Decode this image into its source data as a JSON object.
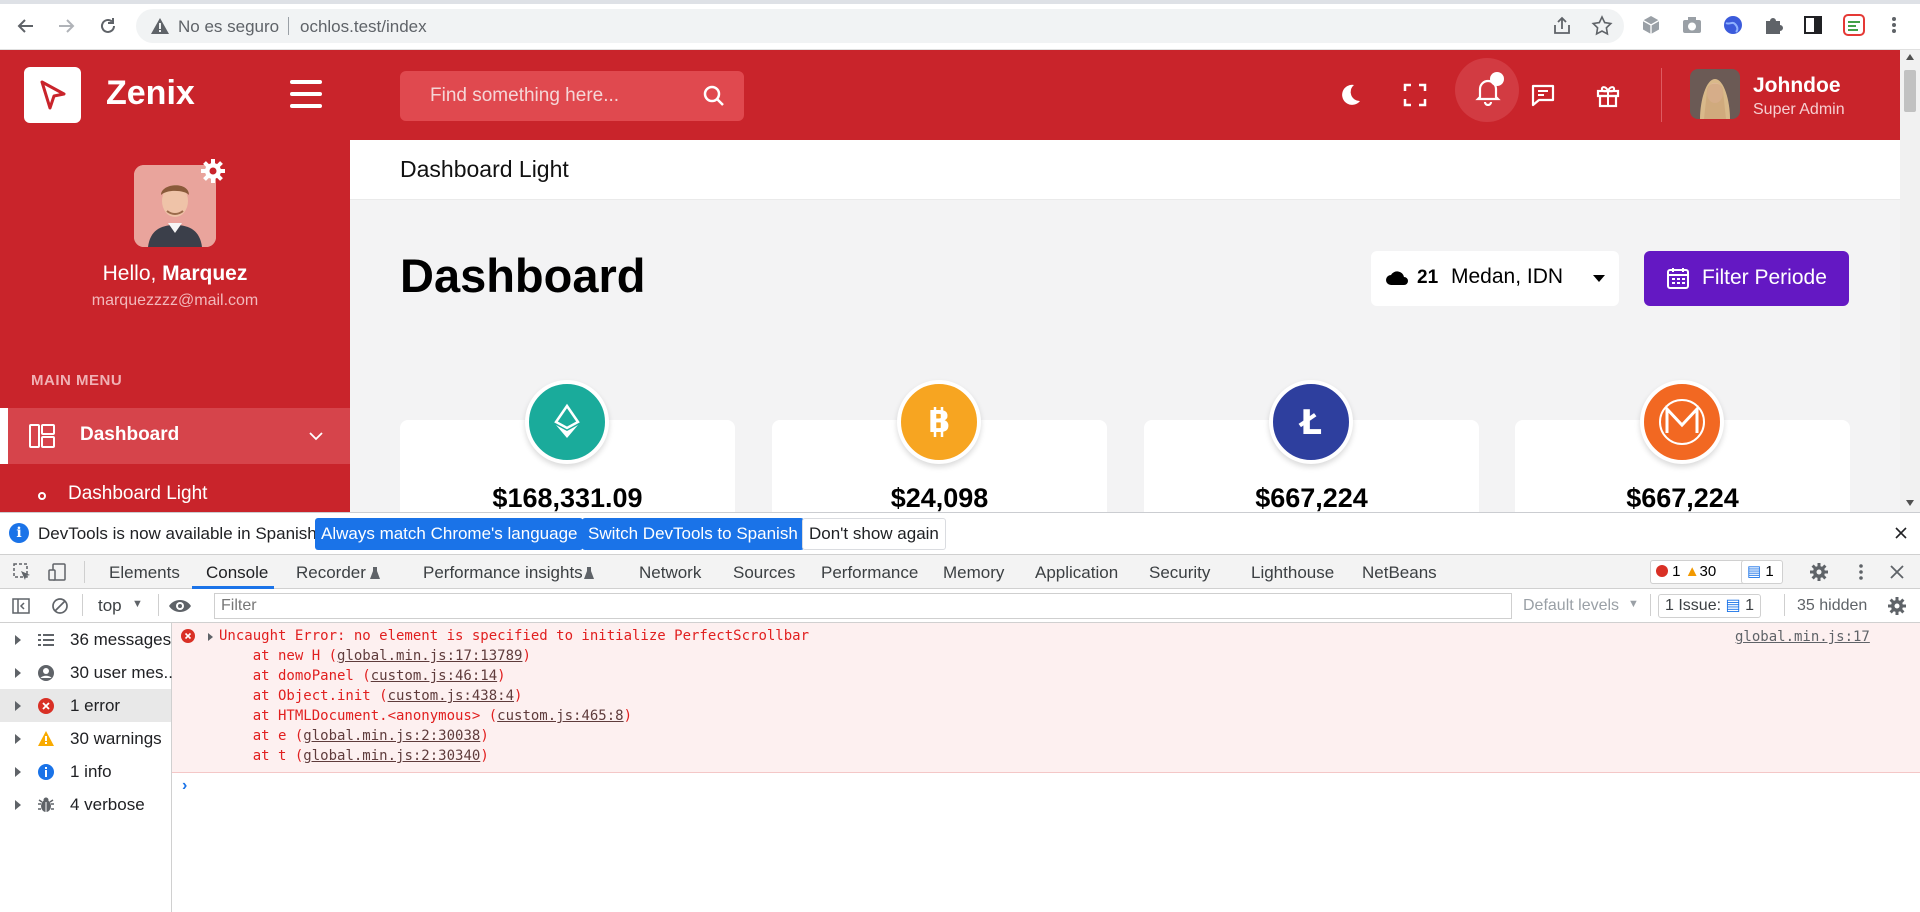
{
  "browser": {
    "security_label": "No es seguro",
    "url": "ochlos.test/index"
  },
  "header": {
    "brand": "Zenix",
    "search_placeholder": "Find something here...",
    "user_name": "Johndoe",
    "user_role": "Super Admin",
    "accent_color": "#c9242b"
  },
  "sidebar": {
    "hello_prefix": "Hello, ",
    "hello_name": "Marquez",
    "email": "marquezzzz@mail.com",
    "menu_title": "MAIN MENU",
    "active_item": "Dashboard",
    "sub_item": "Dashboard Light"
  },
  "main": {
    "breadcrumb": "Dashboard Light",
    "title": "Dashboard",
    "weather_temp": "21",
    "weather_location": "Medan, IDN",
    "filter_button": "Filter Periode",
    "filter_button_color": "#6418c3",
    "coins": [
      {
        "name": "ethereum-icon",
        "color": "#1aab9b",
        "value": "$168,331.09"
      },
      {
        "name": "bitcoin-icon",
        "color": "#f7a521",
        "value": "$24,098"
      },
      {
        "name": "litecoin-icon",
        "color": "#2e3f9e",
        "value": "$667,224"
      },
      {
        "name": "monero-icon",
        "color": "#f26822",
        "value": "$667,224"
      }
    ]
  },
  "devtools": {
    "info_text": "DevTools is now available in Spanish!",
    "btn_match": "Always match Chrome's language",
    "btn_switch": "Switch DevTools to Spanish",
    "btn_dismiss": "Don't show again",
    "tabs": [
      "Elements",
      "Console",
      "Recorder",
      "Performance insights",
      "Network",
      "Sources",
      "Performance",
      "Memory",
      "Application",
      "Security",
      "Lighthouse",
      "NetBeans"
    ],
    "error_count": "1",
    "warning_count": "30",
    "info_count": "1",
    "context": "top",
    "filter_placeholder": "Filter",
    "default_levels": "Default levels",
    "issues_label": "1 Issue:",
    "issues_count": "1",
    "hidden_label": "35 hidden",
    "sidebar_items": [
      {
        "label": "36 messages",
        "icon": "list-icon"
      },
      {
        "label": "30 user mes...",
        "icon": "user-icon"
      },
      {
        "label": "1 error",
        "icon": "error-icon"
      },
      {
        "label": "30 warnings",
        "icon": "warning-icon"
      },
      {
        "label": "1 info",
        "icon": "info-icon"
      },
      {
        "label": "4 verbose",
        "icon": "bug-icon"
      }
    ],
    "error": {
      "message": "Uncaught Error: no element is specified to initialize PerfectScrollbar",
      "source": "global.min.js:17",
      "stack": [
        {
          "prefix": "    at new H (",
          "link": "global.min.js:17:13789",
          "suffix": ")"
        },
        {
          "prefix": "    at domoPanel (",
          "link": "custom.js:46:14",
          "suffix": ")"
        },
        {
          "prefix": "    at Object.init (",
          "link": "custom.js:438:4",
          "suffix": ")"
        },
        {
          "prefix": "    at HTMLDocument.<anonymous> (",
          "link": "custom.js:465:8",
          "suffix": ")"
        },
        {
          "prefix": "    at e (",
          "link": "global.min.js:2:30038",
          "suffix": ")"
        },
        {
          "prefix": "    at t (",
          "link": "global.min.js:2:30340",
          "suffix": ")"
        }
      ]
    }
  }
}
